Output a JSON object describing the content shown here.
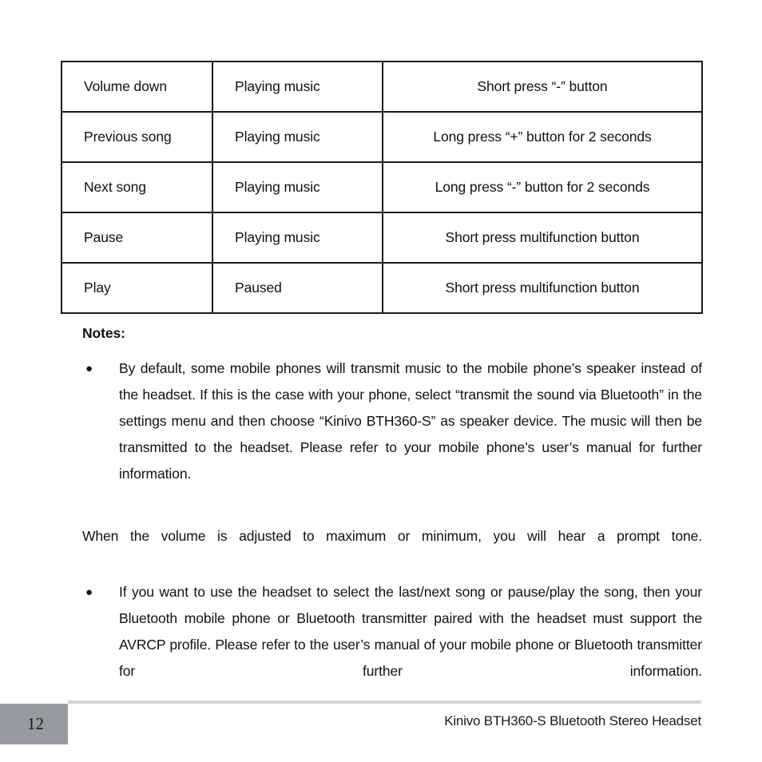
{
  "document": {
    "page_number": "12",
    "footer_title": "Kinivo BTH360-S Bluetooth Stereo Headset"
  },
  "table": {
    "columns": [
      "action",
      "state",
      "operation"
    ],
    "rows": [
      {
        "action": "Volume down",
        "state": "Playing music",
        "operation": "Short press “-” button"
      },
      {
        "action": "Previous song",
        "state": "Playing music",
        "operation": "Long press “+” button for 2 seconds"
      },
      {
        "action": "Next song",
        "state": "Playing music",
        "operation": "Long press “-” button for 2 seconds"
      },
      {
        "action": "Pause",
        "state": "Playing music",
        "operation": "Short press multifunction button"
      },
      {
        "action": "Play",
        "state": "Paused",
        "operation": "Short press multifunction button"
      }
    ]
  },
  "notes": {
    "heading": "Notes:",
    "bullet_glyph": "●",
    "item_1": "By default, some mobile phones will transmit music to the mobile phone’s speaker instead of the headset. If this is the case with your phone, select “transmit the sound via Bluetooth” in the settings menu and then choose “Kinivo BTH360-S” as speaker device. The music will then be transmitted to the headset. Please refer to your mobile phone’s user’s manual for further information.",
    "paragraph_middle": "When the volume is adjusted to maximum or minimum, you will hear a prompt tone.",
    "item_2": "If you want to use the headset to select the last/next song or pause/play the song, then your Bluetooth mobile phone or Bluetooth transmitter paired with the headset must support the AVRCP profile. Please refer to the user’s manual of your mobile phone or Bluetooth transmitter for further information."
  },
  "colors": {
    "page_background": "#ffffff",
    "text": "#111111",
    "table_border": "#1a1a1a",
    "footer_rule": "#d4d4d4",
    "footer_pagebox": "#979aa0"
  }
}
